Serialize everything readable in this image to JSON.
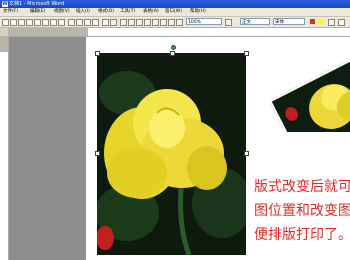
{
  "titlebar": {
    "title": "文档1 - Microsoft Word",
    "icon": "word-icon"
  },
  "menu": {
    "items": [
      "文件(F)",
      "编辑(E)",
      "视图(V)",
      "插入(I)",
      "格式(O)",
      "工具(T)",
      "表格(A)",
      "窗口(W)",
      "帮助(H)"
    ]
  },
  "toolbar": {
    "zoom": "100%",
    "style": "正文",
    "font": "宋体"
  },
  "document": {
    "paragraph": [
      "版式改变后就可",
      "图位置和改变图",
      "便排版打印了。"
    ]
  },
  "colors": {
    "titlebar": "#1c49b9",
    "text_red": "#e02a24",
    "rose_yellow": "#f2e23a"
  }
}
